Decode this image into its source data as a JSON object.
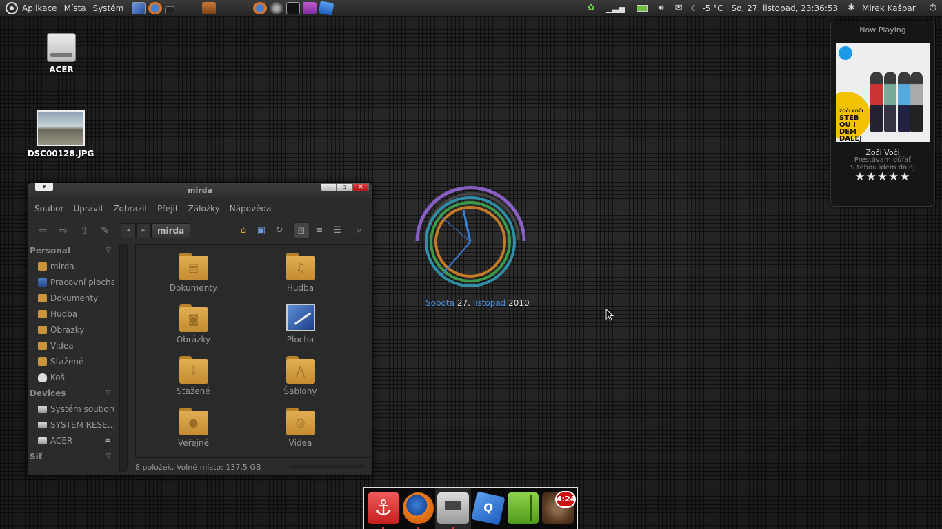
{
  "top_panel": {
    "menus": [
      "Aplikace",
      "Místa",
      "Systém"
    ],
    "temperature": "-5 °C",
    "datetime": "So, 27. listopad, 23:36:53",
    "user": "Mirek Kašpar"
  },
  "desktop": {
    "icons": [
      {
        "label": "ACER"
      },
      {
        "label": "DSC00128.JPG"
      }
    ]
  },
  "file_manager": {
    "title": "mirda",
    "menu": [
      "Soubor",
      "Upravit",
      "Zobrazit",
      "Přejít",
      "Záložky",
      "Nápověda"
    ],
    "path": "mirda",
    "sidebar": {
      "personal_header": "Personal",
      "personal": [
        "mirda",
        "Pracovní plocha",
        "Dokumenty",
        "Hudba",
        "Obrázky",
        "Videa",
        "Stažené",
        "Koš"
      ],
      "devices_header": "Devices",
      "devices": [
        "Systém souborů",
        "SYSTEM RESE...",
        "ACER"
      ],
      "network_header": "Síť"
    },
    "items": [
      "Dokumenty",
      "Hudba",
      "Obrázky",
      "Plocha",
      "Stažené",
      "Šablony",
      "Veřejné",
      "Videa"
    ],
    "status": "8 položek, Volné místo: 137,5 GB"
  },
  "clock": {
    "day": "Sobota",
    "date": "27.",
    "month": "listopad",
    "year": "2010"
  },
  "now_playing": {
    "title": "Now Playing",
    "cover_text": [
      "ZOČI VOČI",
      "STEB",
      "OU I",
      "DEM",
      "DALEJ"
    ],
    "artist": "Zoči Voči",
    "album": "Prestávam dúfať",
    "song": "S tebou idem ďalej",
    "stars": "★★★★★",
    "rating": 5
  },
  "dock": {
    "badge": "4:24"
  }
}
